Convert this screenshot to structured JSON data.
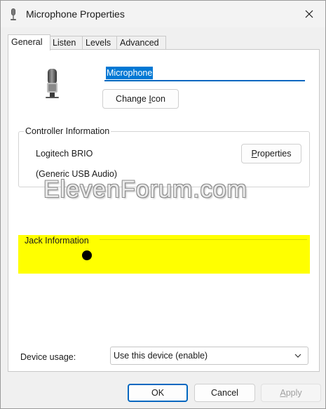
{
  "window": {
    "title": "Microphone Properties"
  },
  "tabs": [
    {
      "label": "General",
      "active": true
    },
    {
      "label": "Listen",
      "active": false
    },
    {
      "label": "Levels",
      "active": false
    },
    {
      "label": "Advanced",
      "active": false
    }
  ],
  "general": {
    "device_name": "Microphone",
    "change_icon": {
      "before": "Change ",
      "mnemonic": "I",
      "after": "con"
    },
    "controller": {
      "title": "Controller Information",
      "name": "Logitech BRIO",
      "driver": "(Generic USB Audio)",
      "properties": {
        "mnemonic": "P",
        "after": "roperties"
      }
    },
    "jack": {
      "title": "Jack Information"
    },
    "device_usage": {
      "label": "Device usage:",
      "value": "Use this device (enable)"
    }
  },
  "watermark": "ElevenForum.com",
  "buttons": {
    "ok": "OK",
    "cancel": "Cancel",
    "apply": {
      "mnemonic": "A",
      "after": "pply"
    }
  },
  "colors": {
    "accent": "#0067c0",
    "selection": "#0078d4",
    "highlight": "#ffff00"
  }
}
